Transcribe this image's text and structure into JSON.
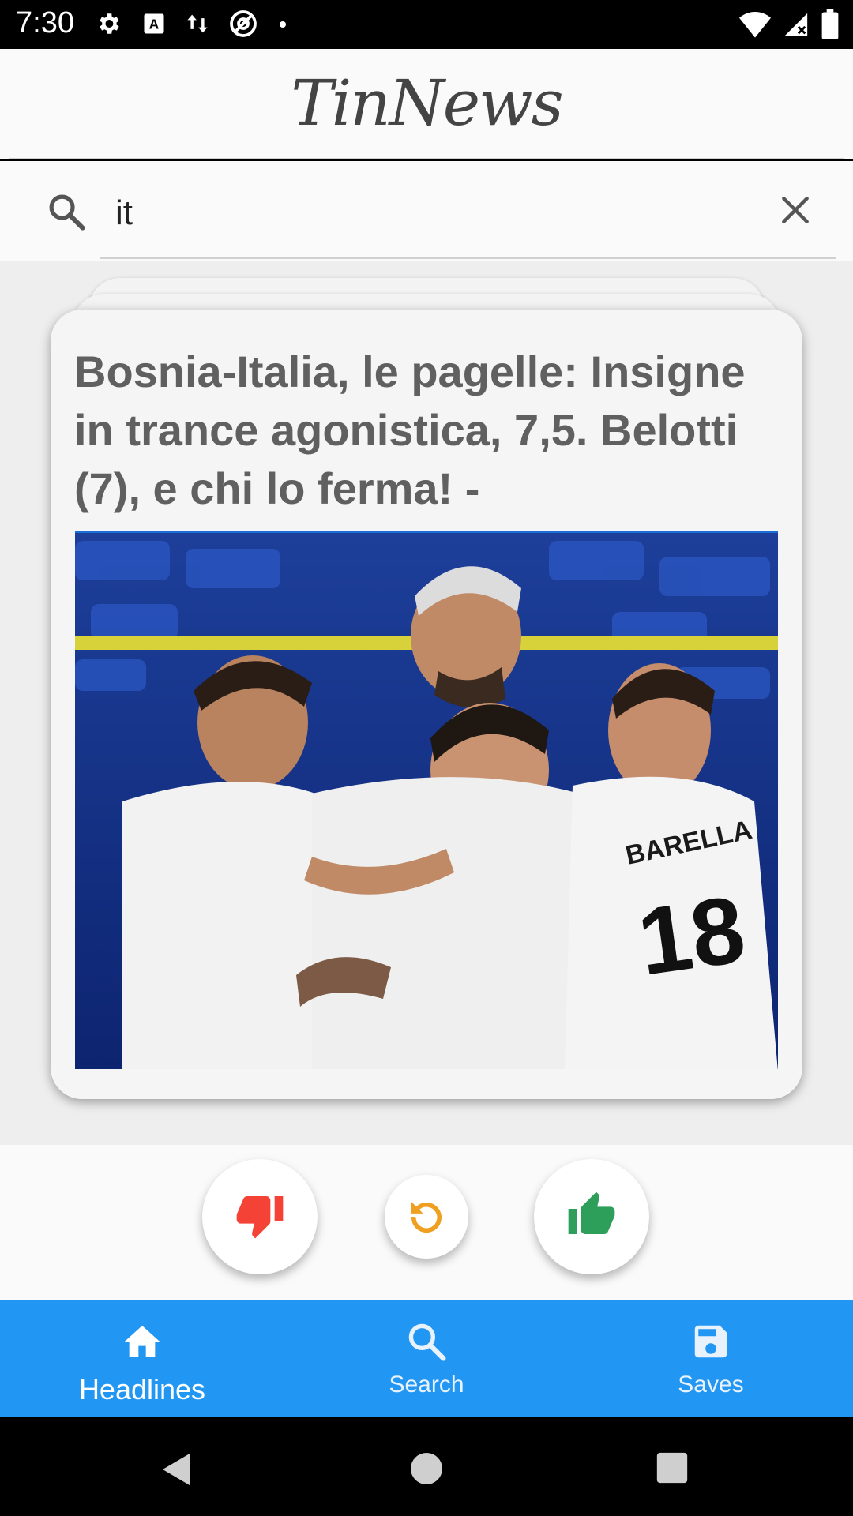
{
  "status_bar": {
    "time": "7:30",
    "left_icons": [
      "gear-icon",
      "text-a-icon",
      "data-transfer-icon",
      "at-sign-icon",
      "dot-icon"
    ],
    "right_icons": [
      "wifi-icon",
      "cell-signal-icon",
      "battery-icon"
    ]
  },
  "header": {
    "title": "TinNews"
  },
  "search": {
    "value": "it",
    "icon": "search-icon",
    "clear_icon": "close-icon"
  },
  "card": {
    "title": "Bosnia-Italia, le pagelle: Insigne in trance agonistica, 7,5. Belotti (7), e chi lo ferma! -",
    "image": "football-players-celebrating-photo",
    "accent_color": "#1a6fd6"
  },
  "actions": {
    "dislike_icon": "thumbs-down-icon",
    "rewind_icon": "rewind-icon",
    "like_icon": "thumbs-up-icon",
    "dislike_color": "#f44336",
    "rewind_color": "#f0a020",
    "like_color": "#2e9e5b"
  },
  "bottom_nav": {
    "color": "#2196f3",
    "items": [
      {
        "label": "Headlines",
        "icon": "home-icon",
        "active": true
      },
      {
        "label": "Search",
        "icon": "search-icon",
        "active": false
      },
      {
        "label": "Saves",
        "icon": "save-icon",
        "active": false
      }
    ]
  },
  "system_nav": {
    "icons": [
      "back-icon",
      "home-circle-icon",
      "recents-icon"
    ]
  }
}
